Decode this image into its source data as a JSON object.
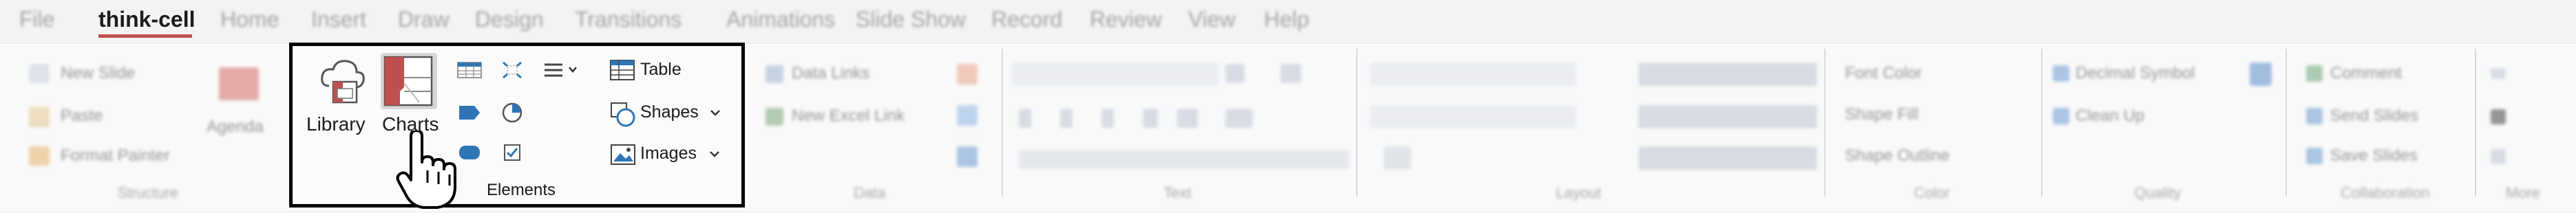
{
  "tabs": [
    {
      "label": "File",
      "blurred": true
    },
    {
      "label": "think-cell",
      "blurred": false,
      "active": true
    },
    {
      "label": "Home",
      "blurred": true
    },
    {
      "label": "Insert",
      "blurred": true
    },
    {
      "label": "Draw",
      "blurred": true
    },
    {
      "label": "Design",
      "blurred": true
    },
    {
      "label": "Transitions",
      "blurred": true
    },
    {
      "label": "Animations",
      "blurred": true
    },
    {
      "label": "Slide Show",
      "blurred": true
    },
    {
      "label": "Record",
      "blurred": true
    },
    {
      "label": "Review",
      "blurred": true
    },
    {
      "label": "View",
      "blurred": true
    },
    {
      "label": "Help",
      "blurred": true
    }
  ],
  "groups": {
    "structure": {
      "label": "Structure",
      "new_slide": "New Slide",
      "paste": "Paste",
      "agenda": "Agenda",
      "format_painter": "Format Painter"
    },
    "data": {
      "label": "Data",
      "data_links": "Data Links",
      "new_excel_link": "New Excel Link"
    },
    "text": {
      "label": "Text"
    },
    "layout": {
      "label": "Layout"
    },
    "color": {
      "label": "Color",
      "font_color": "Font Color",
      "shape_fill": "Shape Fill",
      "shape_outline": "Shape Outline"
    },
    "quality": {
      "label": "Quality",
      "decimal_symbol": "Decimal Symbol",
      "clean_up": "Clean Up"
    },
    "collaboration": {
      "label": "Collaboration",
      "comment": "Comment",
      "send_slides": "Send Slides",
      "save_slides": "Save Slides"
    },
    "more": {
      "label": "More"
    }
  },
  "elements": {
    "label": "Elements",
    "library": "Library",
    "charts": "Charts",
    "table": "Table",
    "shapes": "Shapes",
    "images": "Images"
  },
  "colors": {
    "accent": "#c0504d",
    "icon_blue": "#2e75b6",
    "border": "#000000"
  }
}
